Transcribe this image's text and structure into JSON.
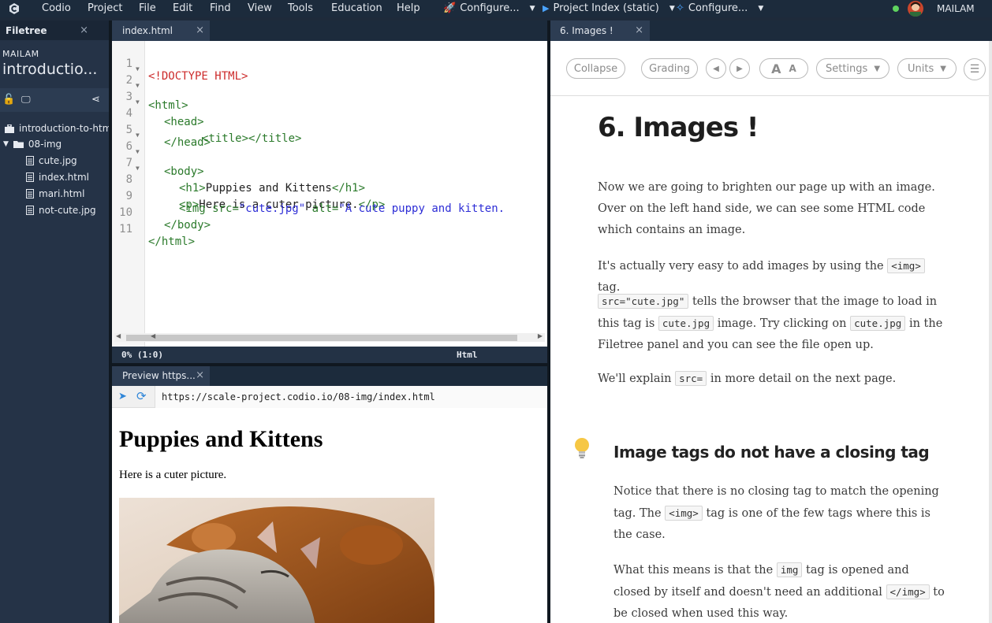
{
  "menubar": {
    "items": [
      "Codio",
      "Project",
      "File",
      "Edit",
      "Find",
      "View",
      "Tools",
      "Education",
      "Help"
    ],
    "tools": [
      {
        "label": "Configure...",
        "icon": "rocket-icon"
      },
      {
        "label": "Project Index (static)",
        "icon": "play-icon"
      },
      {
        "label": "Configure...",
        "icon": "gear-icon"
      }
    ],
    "user": "MAILAM"
  },
  "filetree": {
    "tab_label": "Filetree",
    "owner": "MAILAM",
    "project": "introductio...",
    "root": "introduction-to-html",
    "folder": "08-img",
    "files": [
      "cute.jpg",
      "index.html",
      "mari.html",
      "not-cute.jpg"
    ]
  },
  "editor": {
    "tab_label": "index.html",
    "lines": [
      {
        "n": "1",
        "fold": false
      },
      {
        "n": "2",
        "fold": true
      },
      {
        "n": "3",
        "fold": true
      },
      {
        "n": "4",
        "fold": true
      },
      {
        "n": "5",
        "fold": false
      },
      {
        "n": "6",
        "fold": true
      },
      {
        "n": "7",
        "fold": true
      },
      {
        "n": "8",
        "fold": true
      },
      {
        "n": "9",
        "fold": false
      },
      {
        "n": "10",
        "fold": false
      },
      {
        "n": "11",
        "fold": false
      }
    ],
    "code": {
      "l1": "<!DOCTYPE HTML>",
      "l2": "<html>",
      "l3": "<head>",
      "l4a": "<title>",
      "l4b": "</title>",
      "l5": "</head>",
      "l6": "<body>",
      "l7a": "<h1>",
      "l7b": "Puppies and Kittens",
      "l7c": "</h1>",
      "l8a": "<p>",
      "l8b": "Here is a cuter picture.",
      "l8c": "</p>",
      "l9a": "<img ",
      "l9b": "src=",
      "l9c": "\"cute.jpg\"",
      "l9d": " alt=",
      "l9e": "\"A cute puppy and kitten.",
      "l10": "</body>",
      "l11": "</html>"
    },
    "status_position": "0%  (1:0)",
    "status_mode": "Html"
  },
  "preview": {
    "tab_label": "Preview https...",
    "url": "https://scale-project.codio.io/08-img/index.html",
    "heading": "Puppies and Kittens",
    "paragraph": "Here is a cuter picture."
  },
  "guide": {
    "tab_label": "6. Images !",
    "toolbar": {
      "collapse": "Collapse",
      "grading": "Grading",
      "settings": "Settings",
      "units": "Units"
    },
    "title": "6. Images !",
    "p1": "Now we are going to brighten our page up with an image. Over on the left hand side, we can see some HTML code which contains an image.",
    "p2a": "It's actually very easy to add images by using the",
    "p2code": "<img>",
    "p2b": "tag.",
    "p3code1": "src=\"cute.jpg\"",
    "p3a": "tells the browser that the image to load in this tag is",
    "p3code2": "cute.jpg",
    "p3b": "image. Try clicking on",
    "p3code3": "cute.jpg",
    "p3c": "in the Filetree panel and you can see the file open up.",
    "p4a": "We'll explain",
    "p4code": "src=",
    "p4b": "in more detail on the next page.",
    "tip_title": "Image tags do not have a closing tag",
    "tip1a": "Notice that there is no closing tag to match the opening tag. The",
    "tip1code": "<img>",
    "tip1b": "tag is one of the few tags where this is the case.",
    "tip2a": "What this means is that the",
    "tip2code1": "img",
    "tip2b": "tag is opened and closed by itself and doesn't need an additional",
    "tip2code2": "</img>",
    "tip2c": "to be closed when used this way."
  },
  "colors": {
    "menubar_bg": "#1c2b3c",
    "filetree_bg": "#253347",
    "doctype": "#cc2b2b",
    "tag": "#2b7a2b",
    "string": "#2d2dd6",
    "link_blue": "#2f86d8"
  }
}
